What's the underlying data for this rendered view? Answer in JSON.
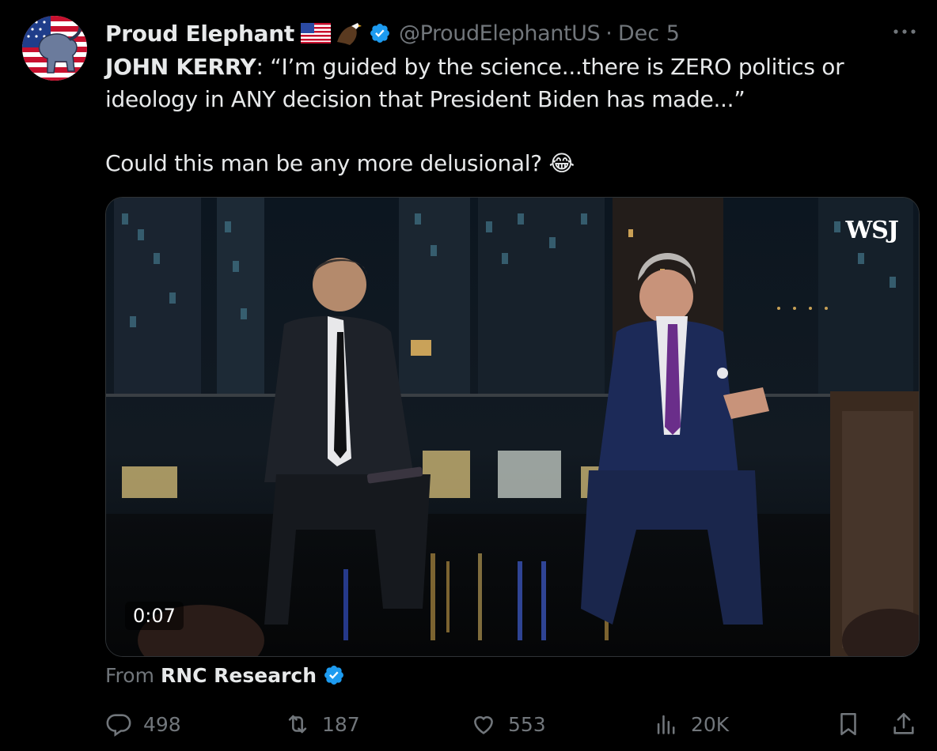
{
  "tweet": {
    "author_name": "Proud Elephant",
    "author_emojis": [
      "flag-us",
      "eagle"
    ],
    "handle": "@ProudElephantUS",
    "separator": "·",
    "date": "Dec 5",
    "text_speaker": "JOHN KERRY",
    "text_quote": ": “I’m guided by the science...there is ZERO politics or ideology in ANY decision that President Biden has made...”",
    "text_comment": "Could this man be any more delusional? ",
    "text_emoji": "😂"
  },
  "media": {
    "duration": "0:07",
    "watermark": "WSJ"
  },
  "attribution": {
    "label": "From",
    "source": "RNC Research"
  },
  "actions": {
    "replies": "498",
    "reposts": "187",
    "likes": "553",
    "views": "20K"
  },
  "colors": {
    "background": "#000000",
    "text": "#e7e9ea",
    "muted": "#71767b",
    "verified": "#1d9bf0",
    "border": "#2f3336"
  }
}
